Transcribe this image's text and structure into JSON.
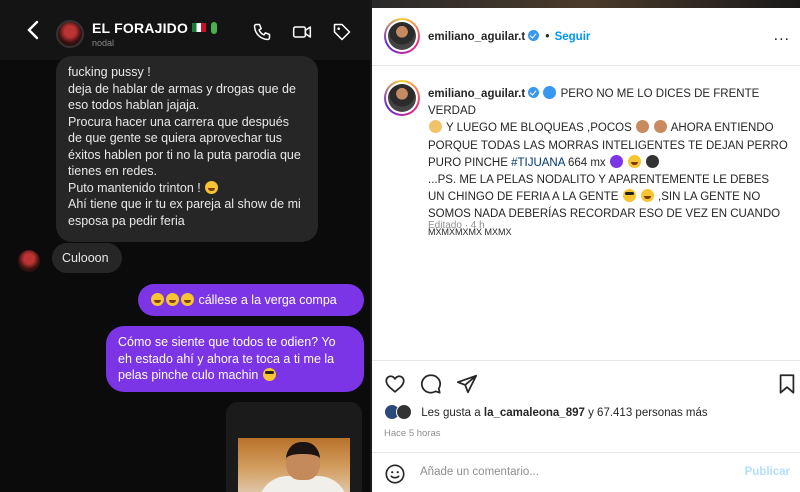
{
  "dm": {
    "contact_name": "EL FORAJIDO",
    "contact_sub": "nodal",
    "back_glyph": "<",
    "icons": [
      "back-icon",
      "phone-icon",
      "video-icon",
      "tag-icon"
    ],
    "messages_in": [
      "fucking pussy !",
      "deja de hablar de armas y drogas que de eso todos hablan jajaja.",
      "Procura hacer una carrera que después de que gente se quiera aprovechar tus éxitos hablen por ti no la puta parodia que tienes en redes.",
      "Puto mantenido trinton !",
      "Ahí tiene que ir tu ex pareja al show de mi esposa pa pedir feria"
    ],
    "message_in_short": "Culooon",
    "message_out_1": "cállese a la verga compa",
    "message_out_2": "Cómo se siente que todos te odien? Yo eh estado ahí y ahora te toca a ti me la pelas pinche culo machin",
    "colors": {
      "bubble_out": "#7b35e6",
      "bubble_in": "#262626",
      "background": "#0b0b0b"
    }
  },
  "ig": {
    "username": "emiliano_aguilar.t",
    "follow_label": "Seguir",
    "more_glyph": "...",
    "caption": {
      "username": "emiliano_aguilar.t",
      "part1": "PERO NO ME LO DICES DE FRENTE VERDAD",
      "part2": "Y LUEGO ME BLOQUEAS ,POCOS",
      "part3": "AHORA ENTIENDO PORQUE TODAS LAS MORRAS INTELIGENTES TE DEJAN PERRO PURO PINCHE",
      "hashtag": "#TIJUANA",
      "part4": "664 mx",
      "part5": "...PS. ME LA PELAS NODALITO Y APARENTEMENTE LE DEBES UN CHINGO DE FERIA A LA GENTE",
      "part6": ",SIN LA GENTE NO SOMOS NADA DEBERÍAS RECORDAR ESO DE VEZ EN CUANDO",
      "part7": "MXMXMXMX MXMX"
    },
    "edited": "Editado · 4 h",
    "likes_prefix": "Les gusta a",
    "likes_user": "la_camaleona_897",
    "likes_suffix": "y 67.413 personas más",
    "time_ago": "Hace 5 horas",
    "comment_placeholder": "Añade un comentario...",
    "publish_label": "Publicar",
    "colors": {
      "link": "#0095f6",
      "hashtag": "#00376b",
      "text": "#262626",
      "muted": "#8e8e8e"
    },
    "icons": [
      "heart-icon",
      "comment-icon",
      "share-icon",
      "bookmark-icon",
      "emoji-icon",
      "more-icon"
    ]
  }
}
